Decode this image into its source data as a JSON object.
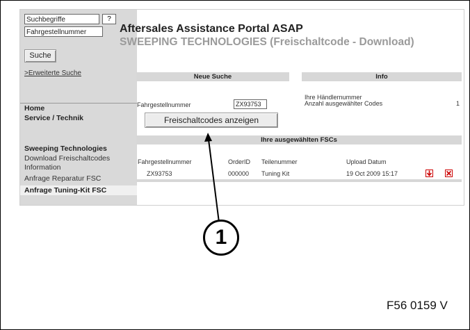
{
  "sidebar": {
    "search_term": "Suchbegriffe",
    "help": "?",
    "vin_field": "Fahrgestellnummer",
    "search_button": "Suche",
    "advanced_search": ">Erweiterte Suche",
    "home": "Home",
    "service": "Service / Technik",
    "section_title": "Sweeping Technologies",
    "items": [
      {
        "label": "Download Freischaltcodes Information"
      },
      {
        "label": "Anfrage Reparatur FSC"
      },
      {
        "label": "Anfrage Tuning-Kit FSC"
      }
    ]
  },
  "header": {
    "title": "Aftersales Assistance Portal ASAP",
    "subtitle": "SWEEPING TECHNOLOGIES (Freischaltcode - Download)"
  },
  "new_search": {
    "heading": "Neue Suche",
    "vin_label": "Fahrgestellnummer",
    "vin_value": "ZX93753",
    "show_button": "Freischaltcodes anzeigen"
  },
  "info": {
    "heading": "Info",
    "rows": [
      {
        "label": "Ihre Händlernummer",
        "value": ""
      },
      {
        "label": "Anzahl ausgewählter Codes",
        "value": "1"
      }
    ]
  },
  "fsc_table": {
    "heading": "Ihre ausgewählten FSCs",
    "columns": [
      "Fahrgestellnummer",
      "OrderID",
      "Teilenummer",
      "Upload Datum"
    ],
    "rows": [
      {
        "vin": "ZX93753",
        "order_id": "000000",
        "part": "Tuning Kit",
        "date": "19 Oct 2009 15:17"
      }
    ]
  },
  "callout": {
    "number": "1"
  },
  "figure_code": "F56 0159 V",
  "colors": {
    "sidebar": "#d9d9d9",
    "header_bar": "#d7d7d7",
    "icon_red": "#cc0000"
  }
}
